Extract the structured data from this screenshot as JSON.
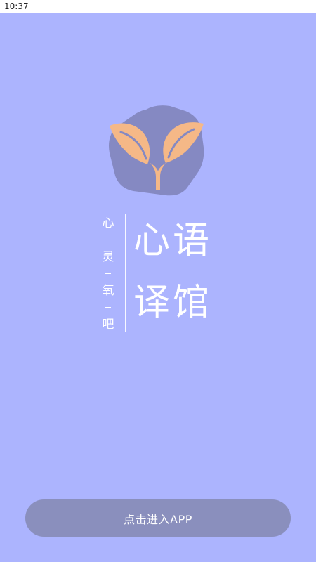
{
  "status_bar": {
    "time": "10:37"
  },
  "logo": {
    "icon": "leaf-sprout-icon",
    "badge_color": "#8589c2",
    "leaf_color": "#f5b887"
  },
  "slogan": {
    "chars": [
      "心",
      "灵",
      "氧",
      "吧"
    ]
  },
  "title": {
    "chars": [
      "心",
      "语",
      "译",
      "馆"
    ]
  },
  "enter_button": {
    "label": "点击进入APP"
  },
  "colors": {
    "background": "#acb4fe",
    "button": "#8a8fbd",
    "text": "#ffffff"
  }
}
